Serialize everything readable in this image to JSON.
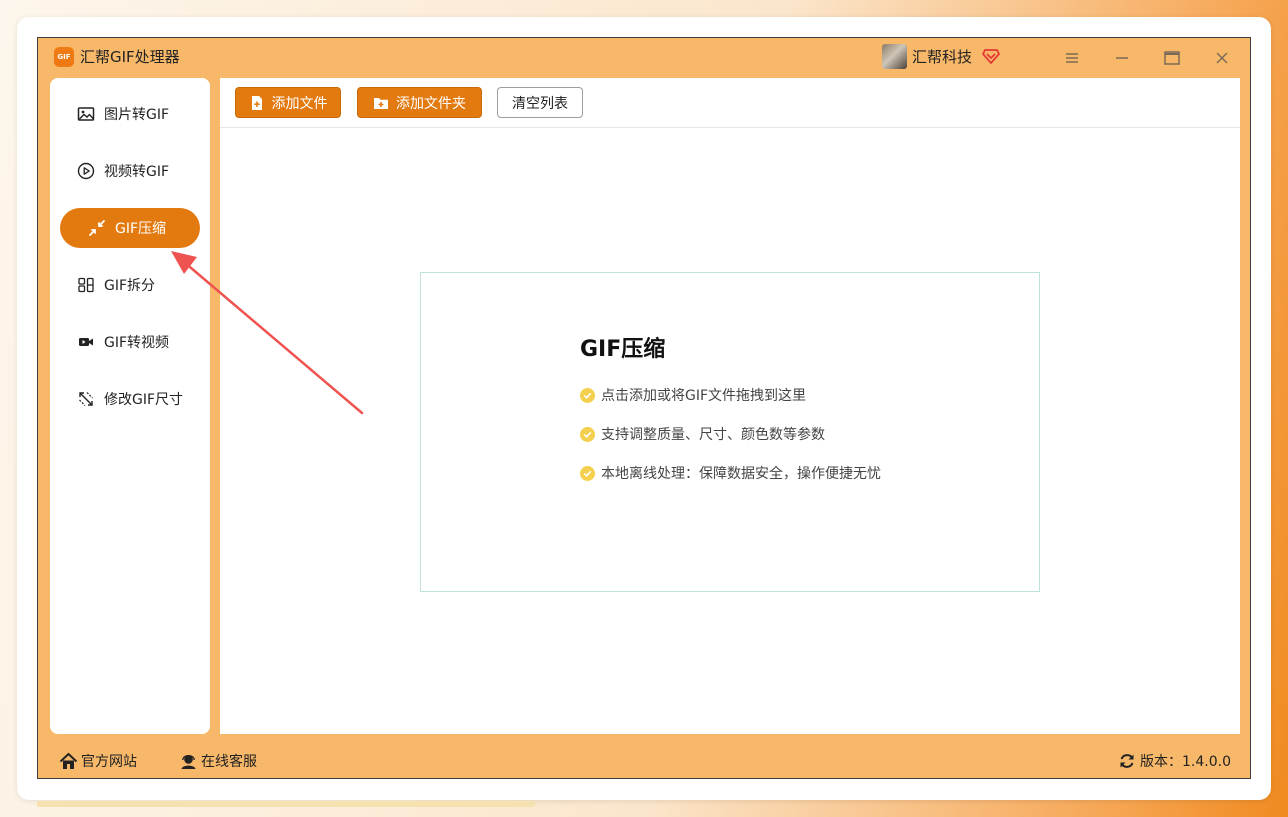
{
  "window": {
    "logo_text": "GIF",
    "title": "汇帮GIF处理器",
    "user_name": "汇帮科技"
  },
  "sidebar": {
    "items": [
      {
        "label": "图片转GIF",
        "icon": "image-icon",
        "active": false
      },
      {
        "label": "视频转GIF",
        "icon": "play-circle-icon",
        "active": false
      },
      {
        "label": "GIF压缩",
        "icon": "compress-icon",
        "active": true
      },
      {
        "label": "GIF拆分",
        "icon": "split-icon",
        "active": false
      },
      {
        "label": "GIF转视频",
        "icon": "video-camera-icon",
        "active": false
      },
      {
        "label": "修改GIF尺寸",
        "icon": "resize-icon",
        "active": false
      }
    ]
  },
  "toolbar": {
    "add_file_label": "添加文件",
    "add_folder_label": "添加文件夹",
    "clear_list_label": "清空列表"
  },
  "dropzone": {
    "title": "GIF压缩",
    "features": [
      "点击添加或将GIF文件拖拽到这里",
      "支持调整质量、尺寸、颜色数等参数",
      "本地离线处理：保障数据安全，操作便捷无忧"
    ]
  },
  "statusbar": {
    "official_site_label": "官方网站",
    "online_service_label": "在线客服",
    "version_label": "版本：1.4.0.0"
  },
  "colors": {
    "window_bg": "#f8b86a",
    "accent": "#e27a10",
    "annotation_arrow": "#ef5350",
    "check": "#f5cf4e"
  }
}
